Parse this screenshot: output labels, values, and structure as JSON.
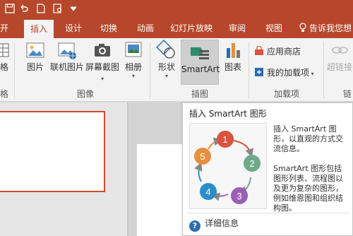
{
  "qat_icons": [
    "save-icon",
    "undo-icon",
    "new-file-icon",
    "preview-icon",
    "customize-qat-icon"
  ],
  "tabs": [
    {
      "label": "开始",
      "active": false
    },
    {
      "label": "插入",
      "active": true
    },
    {
      "label": "设计",
      "active": false
    },
    {
      "label": "切换",
      "active": false
    },
    {
      "label": "动画",
      "active": false
    },
    {
      "label": "幻灯片放映",
      "active": false
    },
    {
      "label": "审阅",
      "active": false
    },
    {
      "label": "视图",
      "active": false
    }
  ],
  "tell_me": "告诉我您想",
  "ribbon": {
    "left_partial_button": "格",
    "left_partial_group": "格",
    "images_group": {
      "label": "图像",
      "buttons": [
        {
          "label": "图片",
          "icon": "picture-icon"
        },
        {
          "label": "联机图片",
          "icon": "online-picture-icon"
        },
        {
          "label": "屏幕截图",
          "icon": "screenshot-icon"
        },
        {
          "label": "相册",
          "icon": "photo-album-icon"
        }
      ]
    },
    "illustrations_group": {
      "label": "插图",
      "buttons": [
        {
          "label": "形状",
          "icon": "shapes-icon"
        },
        {
          "label": "SmartArt",
          "icon": "smartart-icon"
        },
        {
          "label": "图表",
          "icon": "chart-icon"
        }
      ]
    },
    "addins_group": {
      "label": "加载项",
      "buttons": [
        {
          "label": "应用商店",
          "icon": "store-icon"
        },
        {
          "label": "我的加载项",
          "icon": "my-addins-icon"
        }
      ]
    },
    "right_partial_button": "超链接",
    "right_partial_group": "链"
  },
  "tooltip": {
    "title": "插入 SmartArt 图形",
    "desc1": "插入 SmartArt 图形，以直观的方式交流信息。",
    "desc2": "SmartArt 图形包括图形列表、流程图以及更为复杂的图形，例如维恩图和组织结构图。",
    "more_info": "详细信息",
    "diagram_numbers": [
      "1",
      "2",
      "3",
      "4",
      "5"
    ],
    "diagram_colors": [
      "#d9533d",
      "#6daa87",
      "#9a5fb5",
      "#2a8fc8",
      "#e8903d"
    ]
  },
  "colors": {
    "accent": "#b7472a",
    "ribbon_bg": "#f3f3f3",
    "slide_border": "#d04a2c"
  }
}
